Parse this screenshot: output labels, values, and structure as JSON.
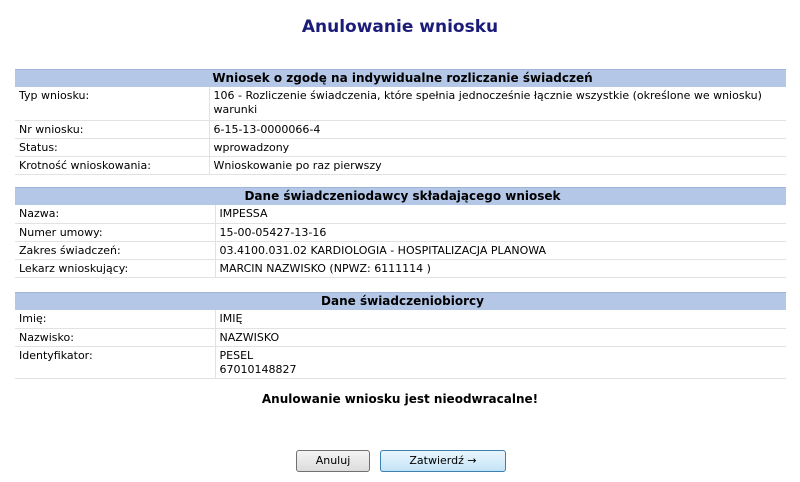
{
  "page": {
    "title": "Anulowanie wniosku",
    "warning": "Anulowanie wniosku jest nieodwracalne!"
  },
  "application": {
    "header": "Wniosek o zgodę na indywidualne rozliczanie świadczeń",
    "rows": [
      {
        "label": "Typ wniosku:",
        "value": "106 - Rozliczenie świadczenia, które spełnia jednocześnie łącznie wszystkie (określone we wniosku) warunki"
      },
      {
        "label": "Nr wniosku:",
        "value": "6-15-13-0000066-4"
      },
      {
        "label": "Status:",
        "value": "wprowadzony"
      },
      {
        "label": "Krotność wnioskowania:",
        "value": "Wnioskowanie po raz pierwszy"
      }
    ]
  },
  "provider": {
    "header": "Dane świadczeniodawcy składającego wniosek",
    "rows": [
      {
        "label": "Nazwa:",
        "value": "IMPESSA"
      },
      {
        "label": "Numer umowy:",
        "value": "15-00-05427-13-16"
      },
      {
        "label": "Zakres świadczeń:",
        "value": "03.4100.031.02 KARDIOLOGIA - HOSPITALIZACJA PLANOWA"
      },
      {
        "label": "Lekarz wnioskujący:",
        "value": "MARCIN NAZWISKO (NPWZ: 6111114 )"
      }
    ]
  },
  "patient": {
    "header": "Dane świadczeniobiorcy",
    "rows": [
      {
        "label": "Imię:",
        "value": "IMIĘ"
      },
      {
        "label": "Nazwisko:",
        "value": "NAZWISKO"
      },
      {
        "label": "Identyfikator:",
        "value": "PESEL",
        "value2": "67010148827"
      }
    ]
  },
  "buttons": {
    "cancel": "Anuluj",
    "confirm": "Zatwierdź →"
  }
}
